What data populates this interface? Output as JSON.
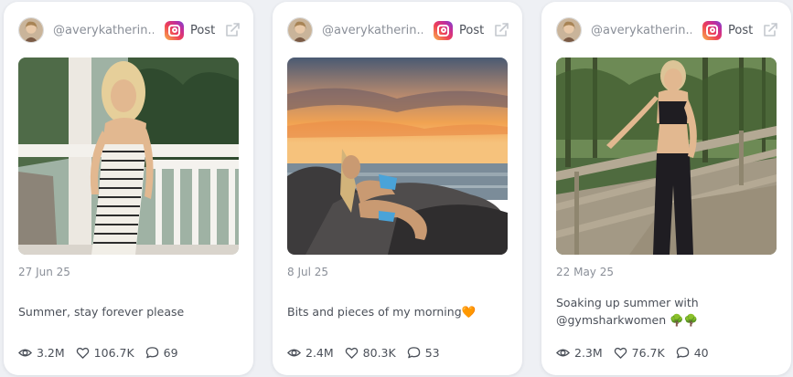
{
  "cards": [
    {
      "handle": "@averykatherin...",
      "post_label": "Post",
      "date": "27 Jun 25",
      "caption": "Summer, stay forever please",
      "views": "3.2M",
      "likes": "106.7K",
      "comments": "69"
    },
    {
      "handle": "@averykatherin...",
      "post_label": "Post",
      "date": "8 Jul 25",
      "caption": "Bits and pieces of my morning🧡",
      "views": "2.4M",
      "likes": "80.3K",
      "comments": "53"
    },
    {
      "handle": "@averykatherin...",
      "post_label": "Post",
      "date": "22 May 25",
      "caption": "Soaking up summer with @gymsharkwomen 🌳🌳",
      "views": "2.3M",
      "likes": "76.7K",
      "comments": "40"
    }
  ],
  "icons": {
    "platform": "instagram-icon",
    "open": "external-link-icon",
    "views": "eye-icon",
    "likes": "heart-icon",
    "comments": "comment-icon"
  },
  "colors": {
    "card_bg": "#ffffff",
    "page_bg": "#eef0f4",
    "muted_text": "#8a8f98",
    "body_text": "#4b5059"
  }
}
